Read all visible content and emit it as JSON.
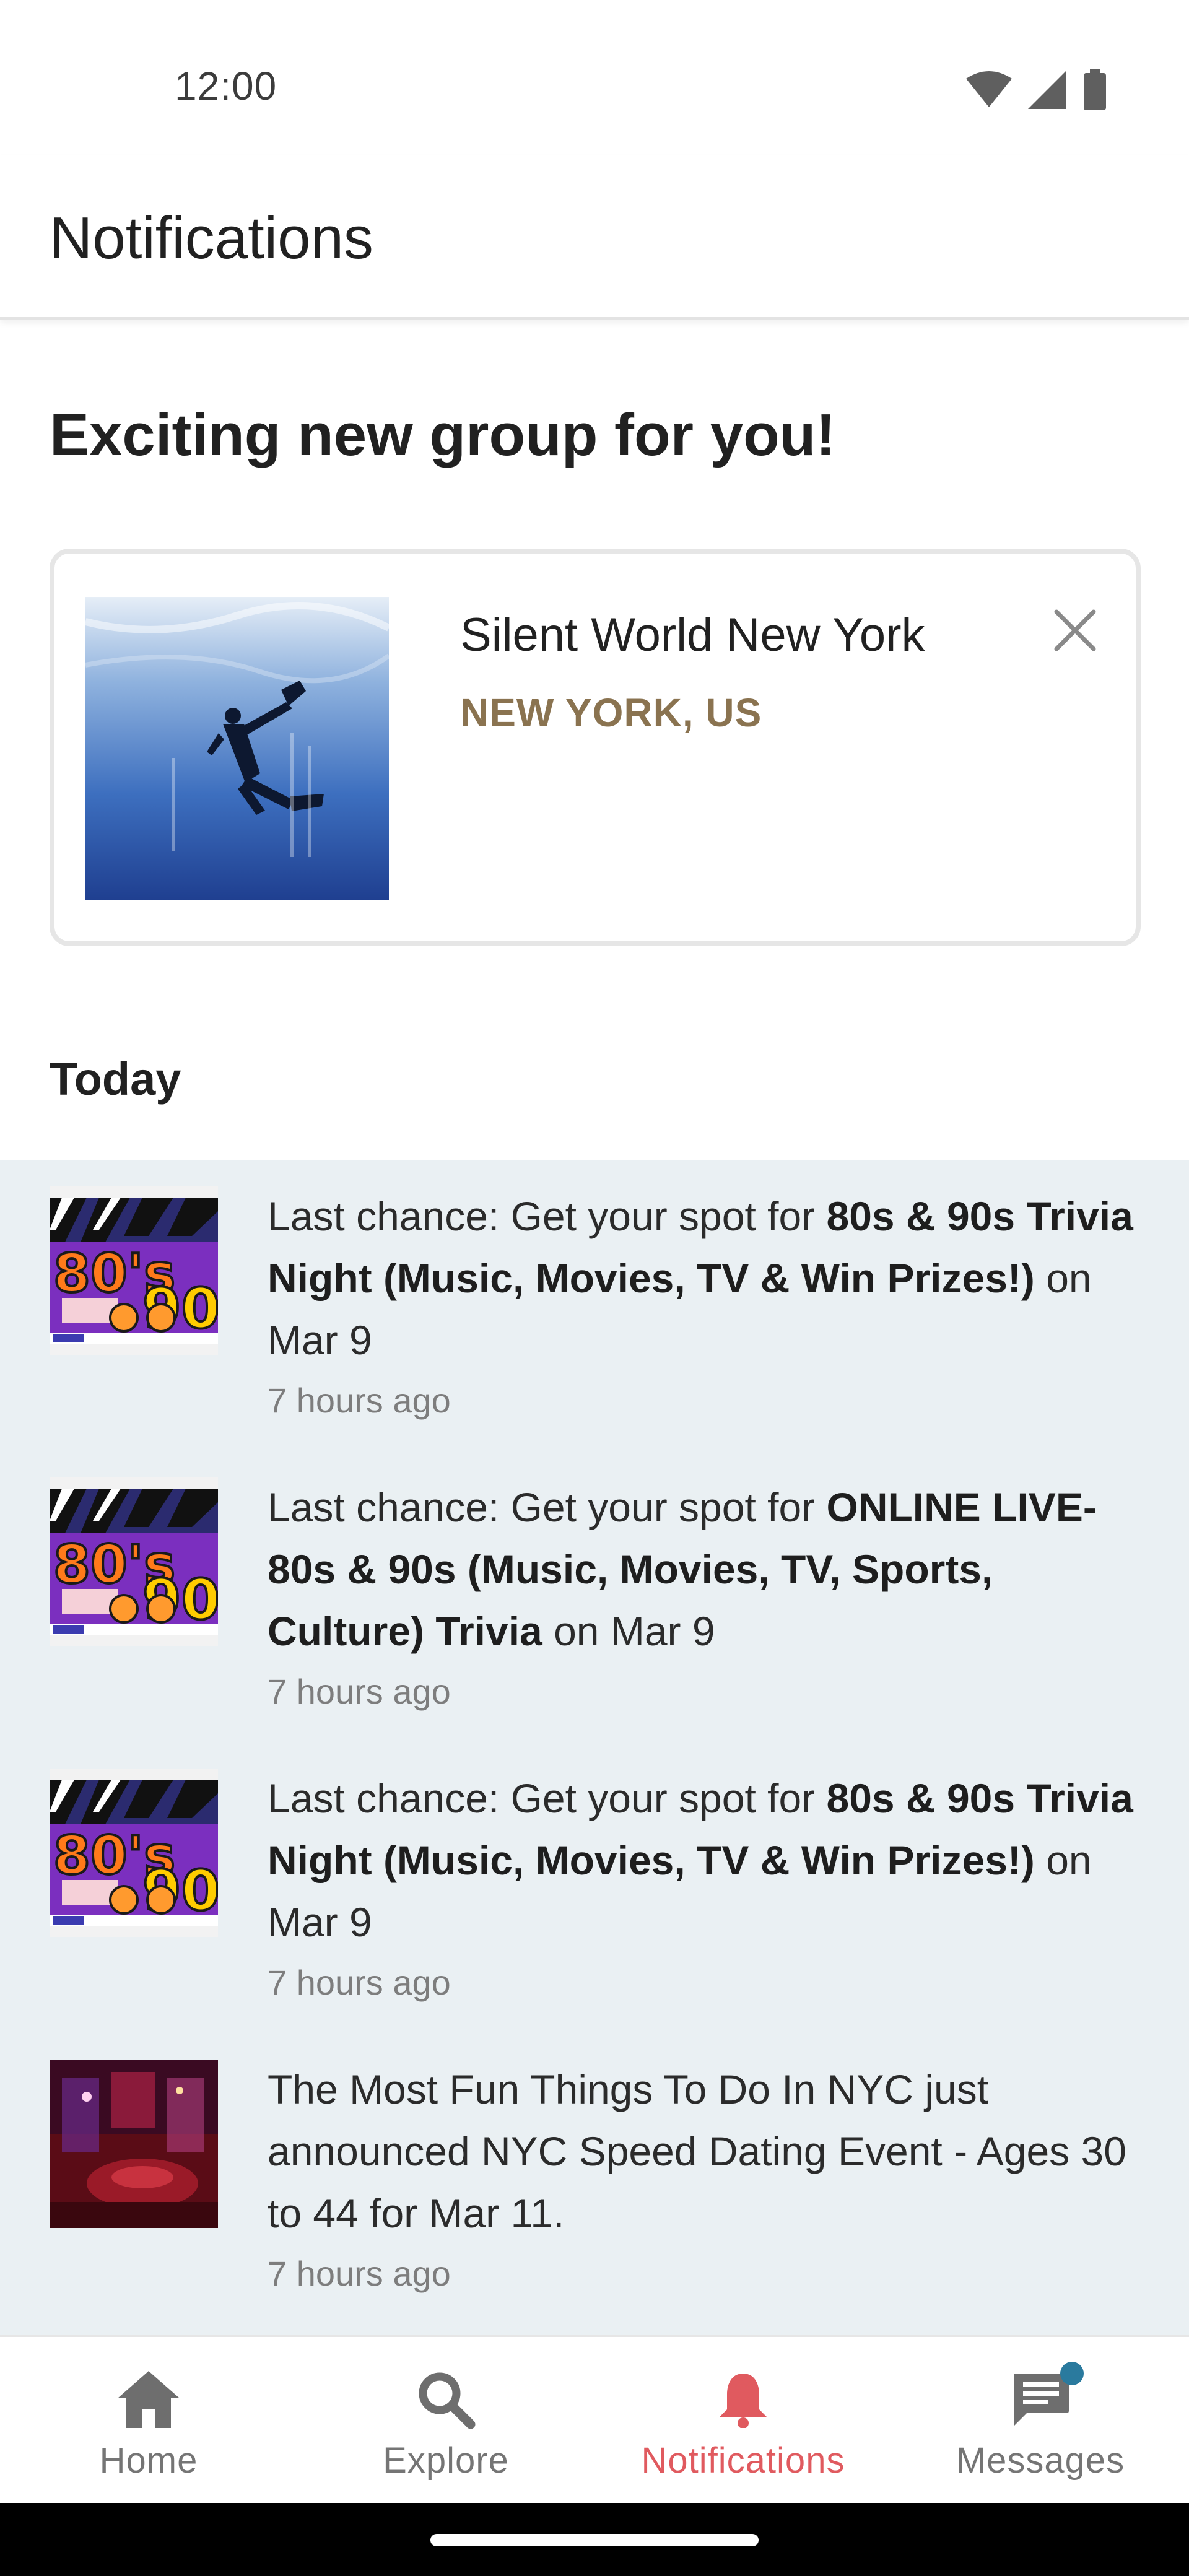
{
  "status_bar": {
    "time": "12:00",
    "icons": [
      "wifi-icon",
      "cell-signal-icon",
      "battery-icon"
    ]
  },
  "app_bar": {
    "title": "Notifications"
  },
  "suggestion": {
    "heading": "Exciting new group for you!",
    "group": {
      "name": "Silent World New York",
      "location": "NEW YORK, US",
      "image": "scuba-diver-photo",
      "dismiss_icon": "close-icon"
    }
  },
  "today": {
    "label": "Today",
    "items": [
      {
        "image": "80s-90s-trivia-poster",
        "prefix": "Last chance: Get your spot for ",
        "bold": "80s & 90s Trivia Night (Music, Movies, TV & Win Prizes!)",
        "suffix": " on Mar 9",
        "time": "7 hours ago"
      },
      {
        "image": "80s-90s-trivia-poster",
        "prefix": "Last chance: Get your spot for ",
        "bold": "ONLINE LIVE- 80s & 90s (Music, Movies, TV, Sports, Culture) Trivia",
        "suffix": " on Mar 9",
        "time": "7 hours ago"
      },
      {
        "image": "80s-90s-trivia-poster",
        "prefix": "Last chance: Get your spot for ",
        "bold": "80s & 90s Trivia Night (Music, Movies, TV & Win Prizes!)",
        "suffix": " on Mar 9",
        "time": "7 hours ago"
      },
      {
        "image": "lounge-photo",
        "prefix": "The Most Fun Things To Do In NYC just announced NYC Speed Dating Event - Ages 30 to 44 for Mar 11.",
        "bold": "",
        "suffix": "",
        "time": "7 hours ago"
      }
    ]
  },
  "bottom_nav": {
    "items": [
      {
        "label": "Home",
        "icon": "home-icon",
        "active": false
      },
      {
        "label": "Explore",
        "icon": "search-icon",
        "active": false
      },
      {
        "label": "Notifications",
        "icon": "bell-icon",
        "active": true
      },
      {
        "label": "Messages",
        "icon": "message-icon",
        "active": false,
        "badge": true
      }
    ]
  },
  "colors": {
    "accent": "#e05a5f",
    "location": "#8a7350",
    "list_background": "#eaf0f3",
    "badge": "#2a7a9e"
  }
}
